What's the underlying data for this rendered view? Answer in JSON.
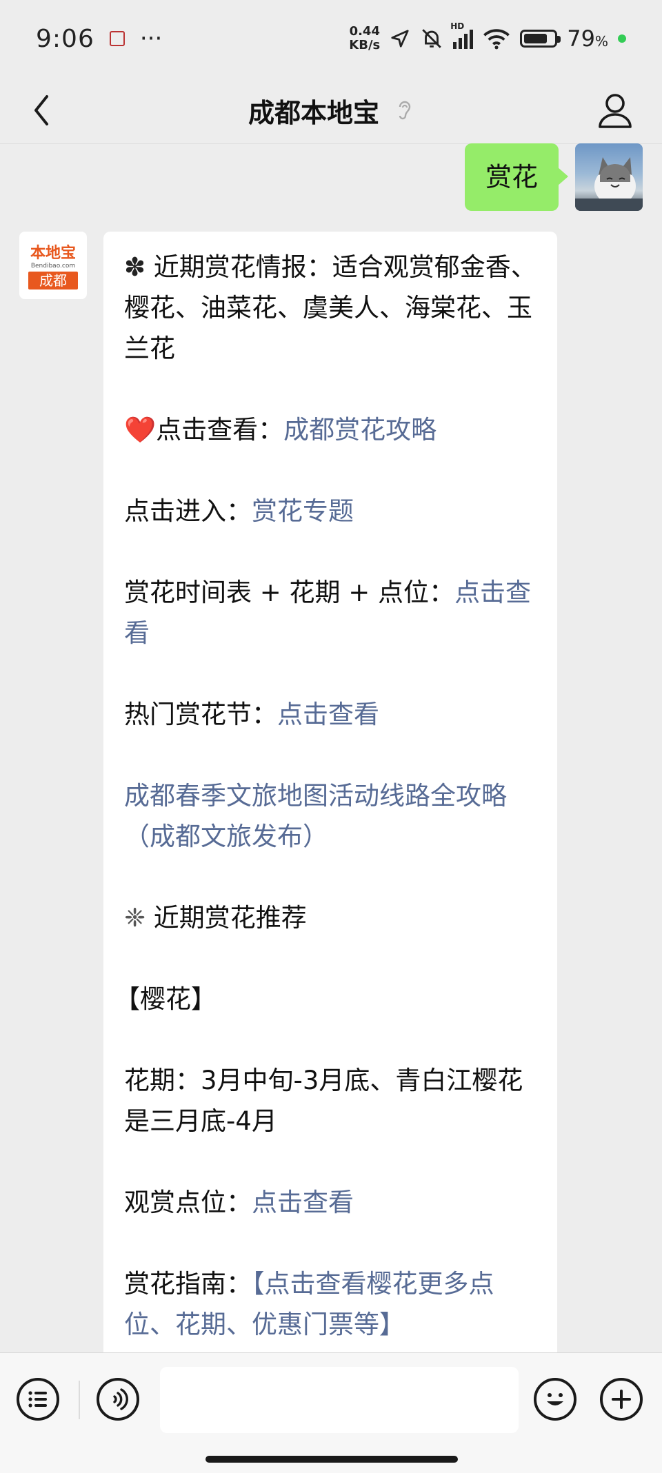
{
  "status_bar": {
    "time": "9:06",
    "more": "···",
    "net_speed_value": "0.44",
    "net_speed_unit": "KB/s",
    "hd": "HD",
    "battery_text": "79",
    "battery_unit": "%",
    "battery_level": 0.79
  },
  "header": {
    "title": "成都本地宝"
  },
  "outgoing_message": {
    "text": "赏花"
  },
  "sender_avatar": {
    "logo_top": "本地宝",
    "logo_mid": "Bendibao.com",
    "logo_bottom": "成都"
  },
  "incoming_message": {
    "intro_prefix": "✽ ",
    "intro_text": "近期赏花情报：适合观赏郁金香、樱花、油菜花、虞美人、海棠花、玉兰花",
    "line1_emoji": "❤️",
    "line1_label": "点击查看：",
    "line1_link": "成都赏花攻略",
    "line2_label": "点击进入：",
    "line2_link": "赏花专题",
    "line3_label": "赏花时间表 + 花期 + 点位：",
    "line3_link": "点击查看",
    "line4_label": "热门赏花节：",
    "line4_link": "点击查看",
    "line5_link": "成都春季文旅地图活动线路全攻略（成都文旅发布）",
    "rec_prefix": "❈ ",
    "rec_title": "近期赏花推荐",
    "section_title": "【樱花】",
    "bloom_text": "花期：3月中旬-3月底、青白江樱花是三月底-4月",
    "spot_label": "观赏点位：",
    "spot_link": "点击查看",
    "guide_label": "赏花指南：",
    "guide_link": "【点击查看樱花更多点位、花期、优惠门票等】"
  },
  "input_bar": {
    "placeholder": ""
  }
}
